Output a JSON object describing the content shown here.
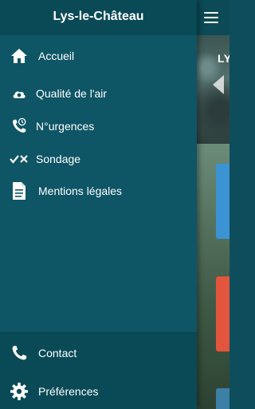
{
  "drawer": {
    "title": "Lys-le-Château",
    "items": [
      {
        "label": "Accueil",
        "icon": "home-icon"
      },
      {
        "label": "Qualité de l'air",
        "icon": "cloud-icon"
      },
      {
        "label": "N°urgences",
        "icon": "emergency-phone-icon"
      },
      {
        "label": "Sondage",
        "icon": "check-cross-icon"
      },
      {
        "label": "Mentions légales",
        "icon": "document-icon"
      }
    ],
    "footer": [
      {
        "label": "Contact",
        "icon": "phone-icon"
      },
      {
        "label": "Préférences",
        "icon": "gear-icon"
      }
    ]
  },
  "app": {
    "header_icon": "menu-icon",
    "hero_title_partial": "LY"
  },
  "colors": {
    "drawer_bg": "#0e5566",
    "header_bg": "#0a4a57",
    "text": "#ffffff",
    "card_blue": "#3b93d3",
    "card_red": "#e3553d"
  }
}
